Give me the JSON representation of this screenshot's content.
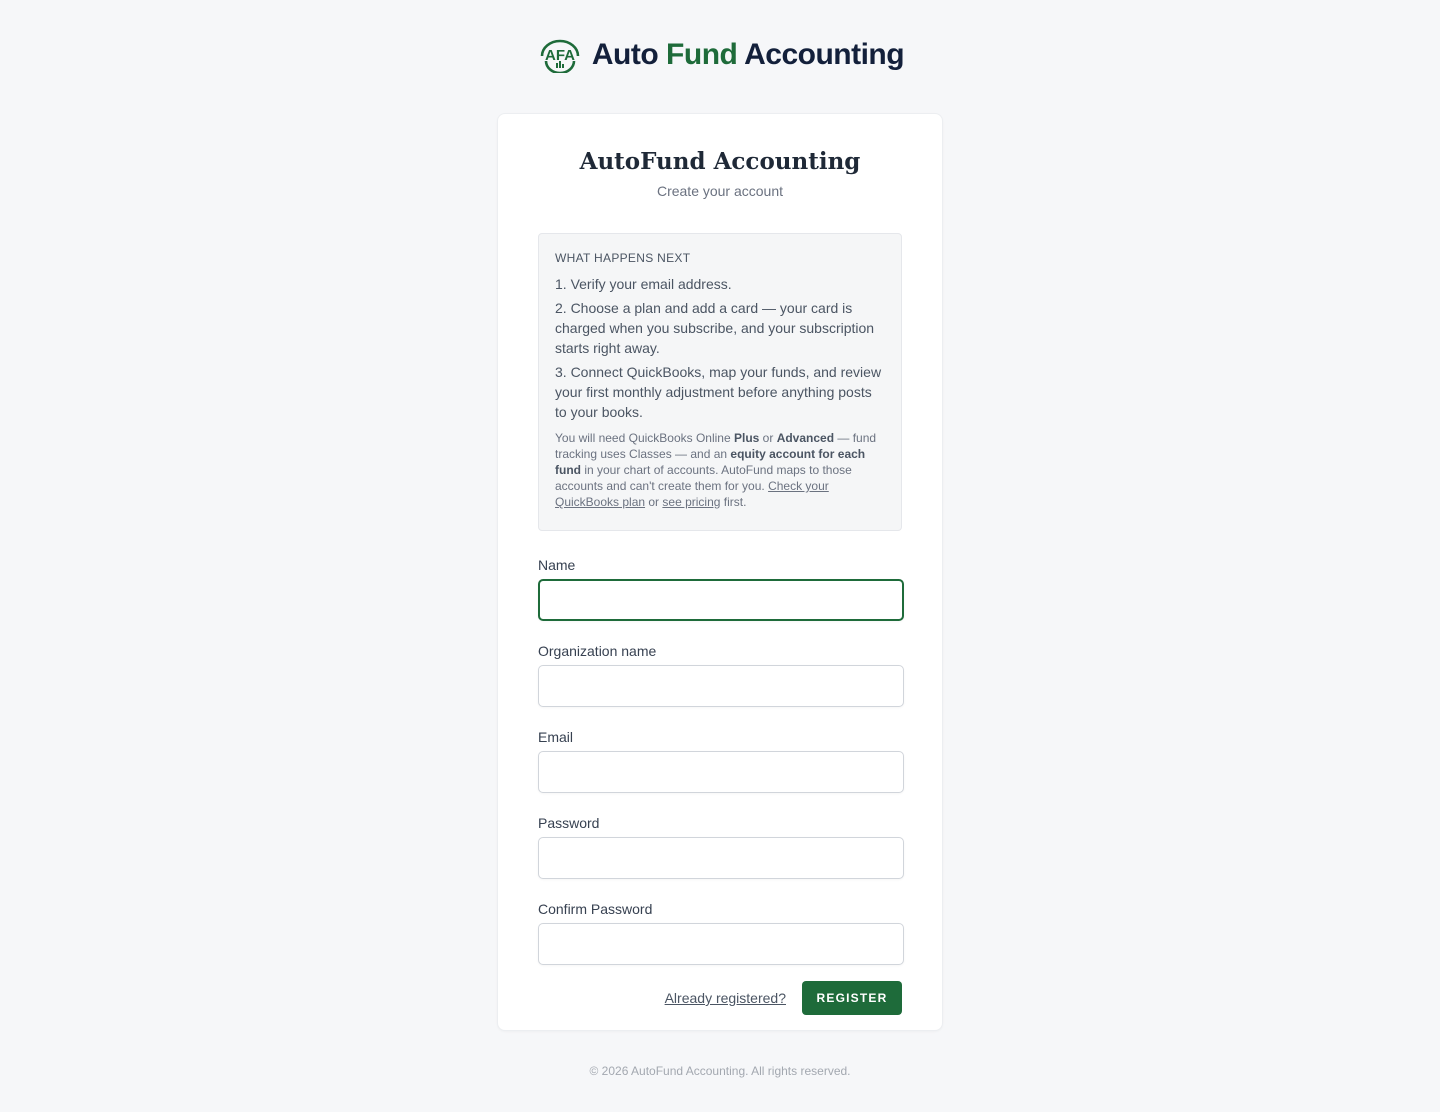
{
  "brand": {
    "logo_mark_text": "AFA",
    "name_part1": "Auto",
    "name_part2": "Fund",
    "name_part3": "Accounting",
    "primary_color": "#1e6b3a",
    "navy_color": "#13203b"
  },
  "card": {
    "title": "AutoFund Accounting",
    "subtitle": "Create your account"
  },
  "info": {
    "heading": "WHAT HAPPENS NEXT",
    "steps": [
      "1. Verify your email address.",
      "2. Choose a plan and add a card — your card is charged when you subscribe, and your subscription starts right away.",
      "3. Connect QuickBooks, map your funds, and review your first monthly adjustment before anything posts to your books."
    ],
    "note": {
      "t1": "You will need QuickBooks Online ",
      "b1": "Plus",
      "t2": " or ",
      "b2": "Advanced",
      "t3": " — fund tracking uses Classes — and an ",
      "b3": "equity account for each fund",
      "t4": " in your chart of accounts. AutoFund maps to those accounts and can't create them for you. ",
      "link1": "Check your QuickBooks plan",
      "t5": " or ",
      "link2": "see pricing",
      "t6": " first."
    }
  },
  "form": {
    "name_label": "Name",
    "name_value": "",
    "org_label": "Organization name",
    "org_value": "",
    "email_label": "Email",
    "email_value": "",
    "password_label": "Password",
    "password_value": "",
    "confirm_label": "Confirm Password",
    "confirm_value": ""
  },
  "actions": {
    "login_link": "Already registered?",
    "register_button": "REGISTER"
  },
  "footer": {
    "copyright": "© 2026 AutoFund Accounting. All rights reserved."
  }
}
